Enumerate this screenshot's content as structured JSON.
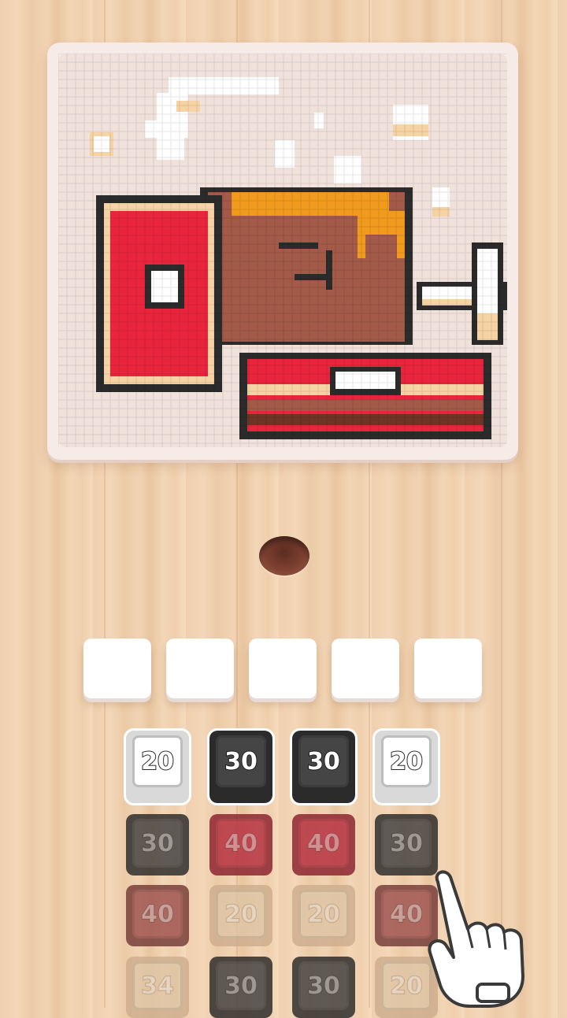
{
  "board": {
    "picture_name": "meat-on-bone pixel art"
  },
  "colors": {
    "black": "#2b2b2b",
    "red": "#e8253d",
    "cream": "#f6d3a5",
    "white": "#ffffff",
    "brown": "#a35a48",
    "orange": "#f09a1e",
    "dark_brown": "#6e3524"
  },
  "slots": [
    {
      "value": ""
    },
    {
      "value": ""
    },
    {
      "value": ""
    },
    {
      "value": ""
    },
    {
      "value": ""
    }
  ],
  "tile_rows": [
    [
      {
        "label": "20",
        "color": "white",
        "state": "active"
      },
      {
        "label": "30",
        "color": "black",
        "state": "active"
      },
      {
        "label": "30",
        "color": "black",
        "state": "active"
      },
      {
        "label": "20",
        "color": "white",
        "state": "active"
      }
    ],
    [
      {
        "label": "30",
        "color": "black",
        "state": "covered"
      },
      {
        "label": "40",
        "color": "red",
        "state": "covered"
      },
      {
        "label": "40",
        "color": "red",
        "state": "covered"
      },
      {
        "label": "30",
        "color": "black",
        "state": "covered"
      }
    ],
    [
      {
        "label": "40",
        "color": "brown",
        "state": "covered"
      },
      {
        "label": "20",
        "color": "cream",
        "state": "covered"
      },
      {
        "label": "20",
        "color": "cream",
        "state": "covered"
      },
      {
        "label": "40",
        "color": "brown",
        "state": "covered"
      }
    ],
    [
      {
        "label": "34",
        "color": "cream",
        "state": "covered"
      },
      {
        "label": "30",
        "color": "black",
        "state": "covered"
      },
      {
        "label": "30",
        "color": "black",
        "state": "covered"
      },
      {
        "label": "20",
        "color": "cream",
        "state": "covered"
      }
    ]
  ],
  "pointer": {
    "icon": "pointing-hand-icon"
  }
}
